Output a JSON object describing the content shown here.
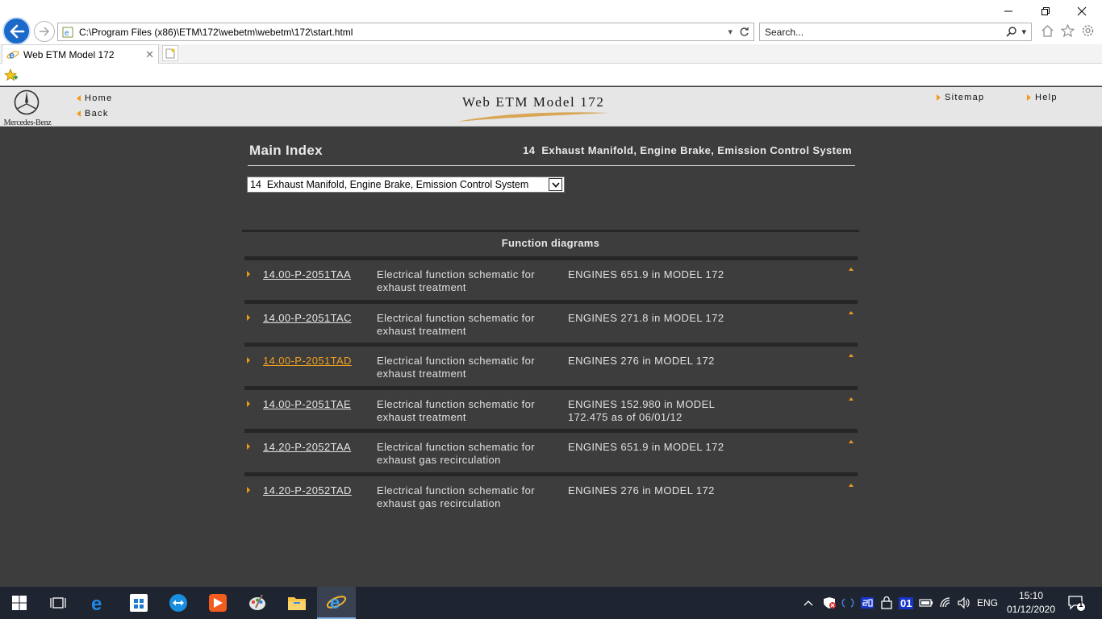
{
  "browser": {
    "address_url": "C:\\Program Files (x86)\\ETM\\172\\webetm\\webetm\\172\\start.html",
    "search_placeholder": "Search...",
    "tab_title": "Web ETM Model 172"
  },
  "header": {
    "brand": "Mercedes-Benz",
    "home_label": "Home",
    "back_label": "Back",
    "title": "Web ETM Model 172",
    "sitemap_label": "Sitemap",
    "help_label": "Help"
  },
  "main": {
    "index_title": "Main Index",
    "section_title": "14  Exhaust Manifold, Engine Brake, Emission Control System",
    "select_value": "14  Exhaust Manifold, Engine Brake, Emission Control System",
    "function_heading": "Function diagrams",
    "diagrams": [
      {
        "code": "14.00-P-2051TAA",
        "desc": "Electrical function schematic for exhaust treatment",
        "engine": "ENGINES 651.9 in MODEL 172"
      },
      {
        "code": "14.00-P-2051TAC",
        "desc": "Electrical function schematic for exhaust treatment",
        "engine": "ENGINES 271.8 in MODEL 172"
      },
      {
        "code": "14.00-P-2051TAD",
        "desc": "Electrical function schematic for exhaust treatment",
        "engine": "ENGINES 276 in MODEL 172"
      },
      {
        "code": "14.00-P-2051TAE",
        "desc": "Electrical function schematic for exhaust treatment",
        "engine": "ENGINES 152.980 in MODEL 172.475 as of 06/01/12"
      },
      {
        "code": "14.20-P-2052TAA",
        "desc": "Electrical function schematic for exhaust gas recirculation",
        "engine": "ENGINES 651.9 in MODEL 172"
      },
      {
        "code": "14.20-P-2052TAD",
        "desc": "Electrical function schematic for exhaust gas recirculation",
        "engine": "ENGINES 276 in MODEL 172"
      }
    ]
  },
  "taskbar": {
    "language": "ENG",
    "time": "15:10",
    "date": "01/12/2020",
    "notification_count": "1",
    "tray_badge_1": "01"
  },
  "colors": {
    "accent_orange": "#f09a1a",
    "background": "#3d3d3d",
    "header_bg": "#e6e6e6",
    "visited_link": "#f0a020"
  }
}
